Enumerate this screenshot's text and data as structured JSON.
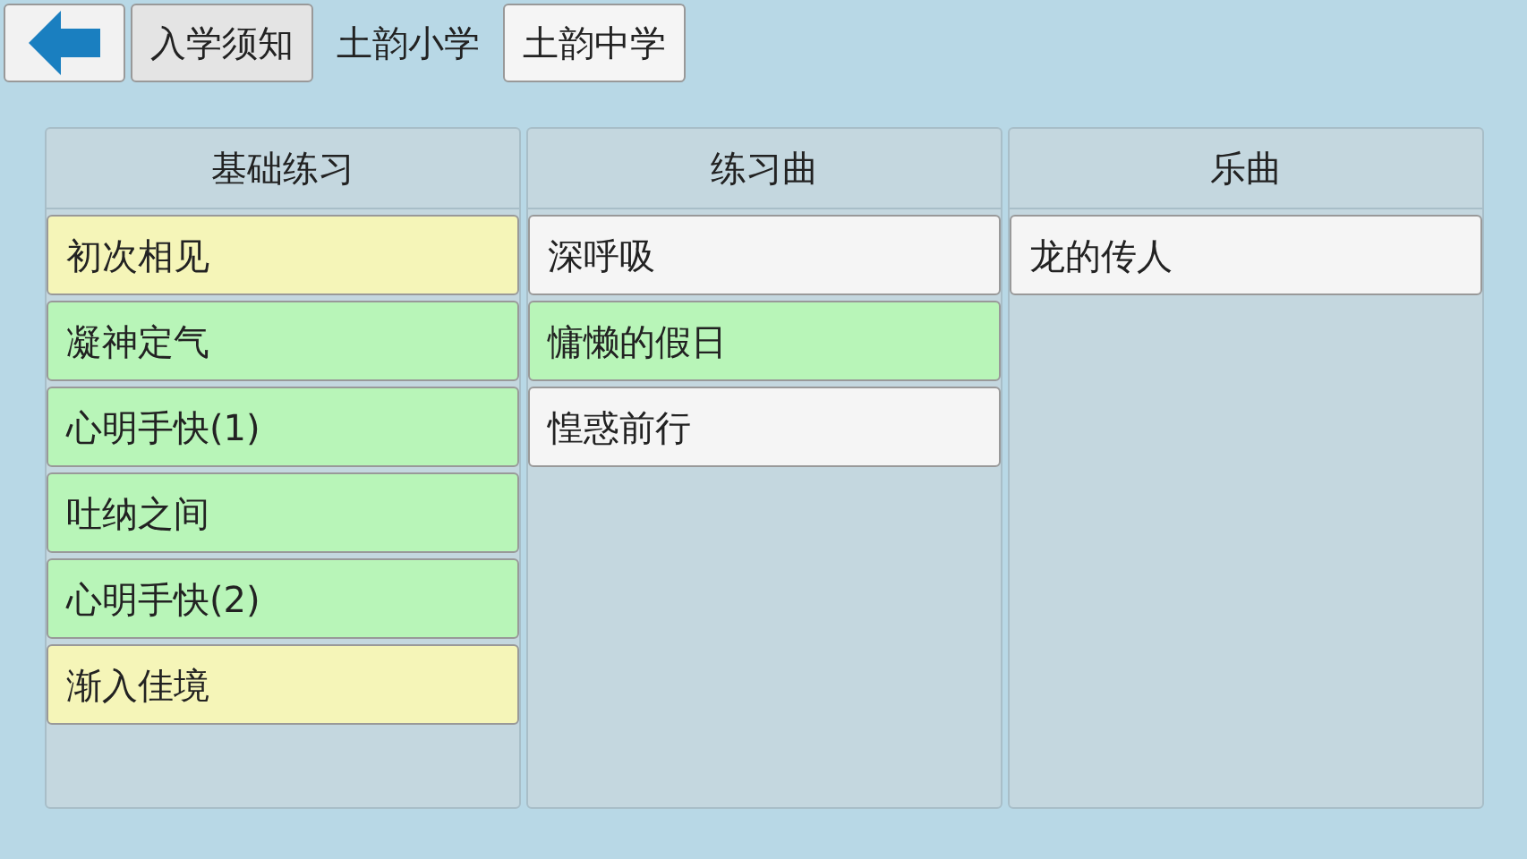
{
  "tabs": [
    {
      "label": "入学须知",
      "selected": false
    },
    {
      "label": "土韵小学",
      "selected": true
    },
    {
      "label": "土韵中学",
      "selected": false
    }
  ],
  "columns": [
    {
      "title": "基础练习",
      "items": [
        {
          "label": "初次相见",
          "color": "#f5f5b8"
        },
        {
          "label": "凝神定气",
          "color": "#b8f5b8"
        },
        {
          "label": "心明手快(1)",
          "color": "#b8f5b8"
        },
        {
          "label": "吐纳之间",
          "color": "#b8f5b8"
        },
        {
          "label": "心明手快(2)",
          "color": "#b8f5b8"
        },
        {
          "label": "渐入佳境",
          "color": "#f5f5b8"
        }
      ]
    },
    {
      "title": "练习曲",
      "items": [
        {
          "label": "深呼吸",
          "color": "#f5f5f5"
        },
        {
          "label": "慵懒的假日",
          "color": "#b8f5b8"
        },
        {
          "label": "惶惑前行",
          "color": "#f5f5f5"
        }
      ]
    },
    {
      "title": "乐曲",
      "items": [
        {
          "label": "龙的传人",
          "color": "#f5f5f5"
        }
      ]
    }
  ]
}
